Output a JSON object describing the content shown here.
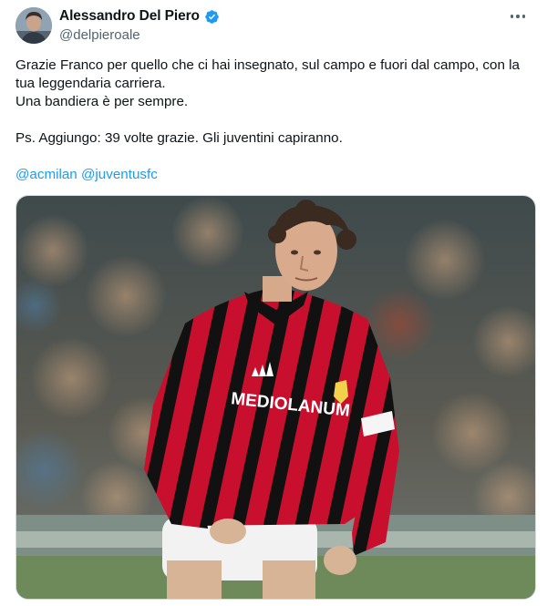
{
  "author": {
    "display_name": "Alessandro Del Piero",
    "handle": "@delpieroale",
    "verified": true,
    "avatar_icon": "profile-photo",
    "verified_icon": "verified-badge-icon",
    "more_icon": "more-options-icon"
  },
  "tweet": {
    "paragraph_1": "Grazie Franco per quello che ci hai insegnato, sul campo e fuori dal campo, con la tua leggendaria carriera.",
    "paragraph_2": "Una bandiera è per sempre.",
    "paragraph_3": "Ps. Aggiungo: 39 volte grazie. Gli juventini capiranno.",
    "mentions": [
      "@acmilan",
      "@juventusfc"
    ]
  },
  "media": {
    "description_icon": "photo",
    "shirt_sponsor": "MEDIOLANUM"
  },
  "colors": {
    "link": "#1d9bf0",
    "verified": "#1d9bf0",
    "secondary_text": "#536471",
    "primary_text": "#0f1419",
    "shirt_red": "#c8102e",
    "shirt_black": "#111111"
  }
}
